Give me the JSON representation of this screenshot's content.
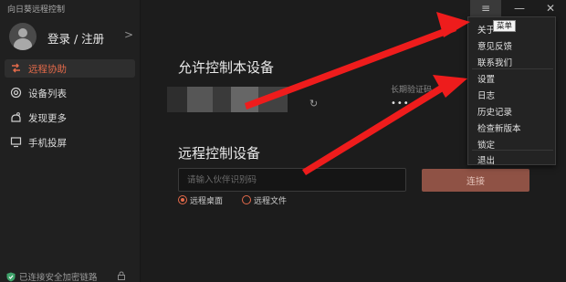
{
  "app": {
    "title": "向日葵远程控制"
  },
  "account": {
    "login_label": "登录 / 注册",
    "chevron": ">"
  },
  "sidebar": {
    "items": [
      {
        "label": "远程协助",
        "icon": "remote-assist-icon",
        "active": true
      },
      {
        "label": "设备列表",
        "icon": "device-list-icon",
        "active": false
      },
      {
        "label": "发现更多",
        "icon": "discover-icon",
        "active": false
      },
      {
        "label": "手机投屏",
        "icon": "screen-cast-icon",
        "active": false
      }
    ],
    "secure_text": "已连接安全加密链路"
  },
  "allow_section": {
    "title": "允许控制本设备",
    "password_label": "长期验证码",
    "password_value": "•••"
  },
  "remote_section": {
    "title": "远程控制设备",
    "input_placeholder": "请输入伙伴识别码",
    "connect_label": "连接",
    "modes": [
      {
        "label": "远程桌面",
        "selected": true
      },
      {
        "label": "远程文件",
        "selected": false
      }
    ]
  },
  "titlebar": {
    "menu_icon": "≡",
    "min_icon": "—",
    "close_icon": "✕"
  },
  "menu": {
    "tooltip": "菜单",
    "group1": [
      "关于",
      "意见反馈",
      "联系我们"
    ],
    "group2": [
      "设置",
      "日志",
      "历史记录",
      "检查新版本",
      "锁定"
    ],
    "group3": [
      "退出"
    ]
  },
  "colors": {
    "accent": "#e46a4a",
    "arrow": "#ee1c1c",
    "connect_button": "#8f5245"
  }
}
